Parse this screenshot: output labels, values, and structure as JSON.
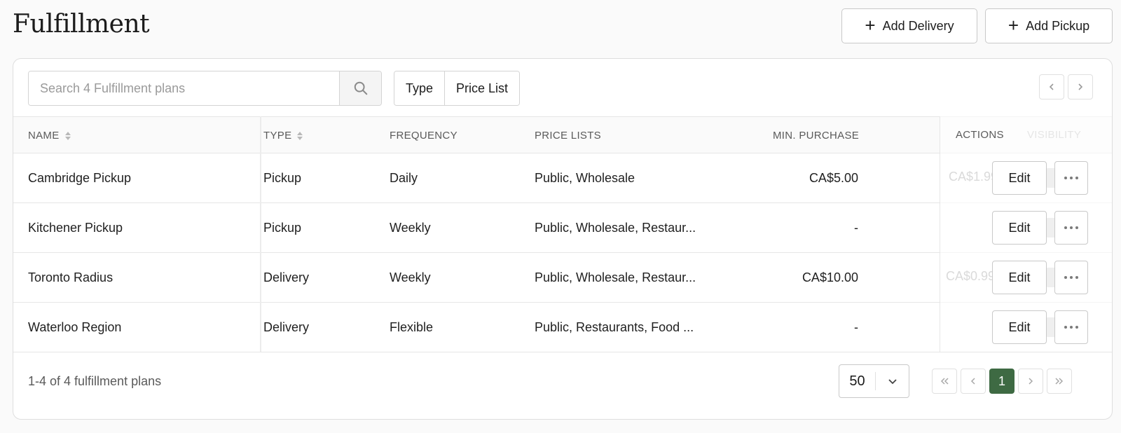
{
  "page": {
    "title": "Fulfillment"
  },
  "header": {
    "add_delivery_label": "Add Delivery",
    "add_pickup_label": "Add Pickup"
  },
  "toolbar": {
    "search_placeholder": "Search 4 Fulfillment plans",
    "filters": [
      "Type",
      "Price List"
    ]
  },
  "table": {
    "columns": {
      "name": "NAME",
      "type": "TYPE",
      "frequency": "FREQUENCY",
      "price_lists": "PRICE LISTS",
      "min_purchase": "MIN. PURCHASE",
      "actions": "ACTIONS",
      "visibility": "VISIBILITY"
    },
    "rows": [
      {
        "name": "Cambridge Pickup",
        "type": "Pickup",
        "frequency": "Daily",
        "price_lists": "Public, Wholesale",
        "min_purchase": "CA$5.00",
        "hidden_fee": "CA$1.99"
      },
      {
        "name": "Kitchener Pickup",
        "type": "Pickup",
        "frequency": "Weekly",
        "price_lists": "Public, Wholesale, Restaur...",
        "min_purchase": "-",
        "hidden_fee": ""
      },
      {
        "name": "Toronto Radius",
        "type": "Delivery",
        "frequency": "Weekly",
        "price_lists": "Public, Wholesale, Restaur...",
        "min_purchase": "CA$10.00",
        "hidden_fee": "CA$0.99"
      },
      {
        "name": "Waterloo Region",
        "type": "Delivery",
        "frequency": "Flexible",
        "price_lists": "Public, Restaurants, Food ...",
        "min_purchase": "-",
        "hidden_fee": ""
      }
    ],
    "edit_label": "Edit"
  },
  "footer": {
    "range_text": "1-4 of 4 fulfillment plans",
    "per_page": "50",
    "current_page": "1"
  },
  "colors": {
    "accent": "#3e6a43",
    "border": "#c9c9c9"
  },
  "icons": [
    "plus-icon",
    "search-icon",
    "chevron-left-icon",
    "chevron-right-icon",
    "sort-icon",
    "more-horizontal-icon",
    "chevron-down-icon",
    "double-chevron-left-icon",
    "double-chevron-right-icon"
  ]
}
